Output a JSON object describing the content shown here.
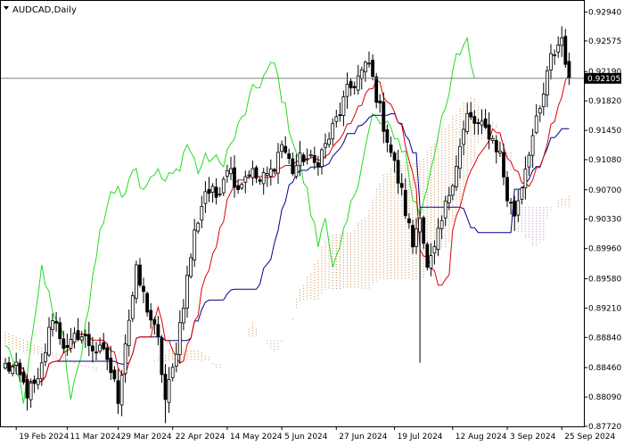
{
  "chart_data": {
    "type": "candlestick",
    "title": "AUDCAD,Daily",
    "symbol": "AUDCAD",
    "timeframe": "Daily",
    "last_price": "0.92105",
    "ylim": [
      0.8772,
      0.9308
    ],
    "y_ticks": [
      "0.92940",
      "0.92575",
      "0.92190",
      "0.91820",
      "0.91450",
      "0.91080",
      "0.90700",
      "0.90330",
      "0.89960",
      "0.89580",
      "0.89210",
      "0.88840",
      "0.88460",
      "0.88090",
      "0.87720"
    ],
    "x_ticks": [
      {
        "index": 3,
        "label": "19 Feb 2024"
      },
      {
        "index": 17,
        "label": "11 Mar 2024"
      },
      {
        "index": 31,
        "label": "29 Mar 2024"
      },
      {
        "index": 46,
        "label": "22 Apr 2024"
      },
      {
        "index": 61,
        "label": "14 May 2024"
      },
      {
        "index": 76,
        "label": "5 Jun 2024"
      },
      {
        "index": 91,
        "label": "27 Jun 2024"
      },
      {
        "index": 107,
        "label": "19 Jul 2024"
      },
      {
        "index": 123,
        "label": "12 Aug 2024"
      },
      {
        "index": 138,
        "label": "3 Sep 2024"
      },
      {
        "index": 153,
        "label": "25 Sep 2024"
      }
    ],
    "series_colors": {
      "bull_body": "#ffffff",
      "bear_body": "#000000",
      "candle_outline": "#000000",
      "tenkan": "#e00000",
      "kijun": "#00008b",
      "chikou": "#22dd22",
      "kumo_bull": "#cd853f",
      "kumo_bear": "#b48cb4",
      "last_price_label_bg": "#000000"
    },
    "close_anchors": [
      [
        0,
        0.8848
      ],
      [
        3,
        0.8842
      ],
      [
        6,
        0.8815
      ],
      [
        9,
        0.8825
      ],
      [
        13,
        0.8912
      ],
      [
        17,
        0.8865
      ],
      [
        20,
        0.889
      ],
      [
        24,
        0.8872
      ],
      [
        28,
        0.8858
      ],
      [
        31,
        0.8808
      ],
      [
        33,
        0.888
      ],
      [
        36,
        0.8965
      ],
      [
        39,
        0.8922
      ],
      [
        42,
        0.8878
      ],
      [
        44,
        0.8805
      ],
      [
        46,
        0.8842
      ],
      [
        49,
        0.893
      ],
      [
        52,
        0.9015
      ],
      [
        55,
        0.907
      ],
      [
        58,
        0.9062
      ],
      [
        61,
        0.9102
      ],
      [
        64,
        0.9075
      ],
      [
        67,
        0.9095
      ],
      [
        70,
        0.908
      ],
      [
        73,
        0.9092
      ],
      [
        76,
        0.9128
      ],
      [
        79,
        0.9095
      ],
      [
        82,
        0.9112
      ],
      [
        85,
        0.9102
      ],
      [
        88,
        0.9125
      ],
      [
        91,
        0.9158
      ],
      [
        94,
        0.9192
      ],
      [
        97,
        0.9212
      ],
      [
        100,
        0.9228
      ],
      [
        103,
        0.917
      ],
      [
        106,
        0.9118
      ],
      [
        109,
        0.9065
      ],
      [
        112,
        0.9
      ],
      [
        114,
        0.9045
      ],
      [
        116,
        0.8968
      ],
      [
        118,
        0.8992
      ],
      [
        121,
        0.9048
      ],
      [
        124,
        0.9105
      ],
      [
        127,
        0.9162
      ],
      [
        130,
        0.915
      ],
      [
        133,
        0.9142
      ],
      [
        136,
        0.9115
      ],
      [
        138,
        0.906
      ],
      [
        140,
        0.904
      ],
      [
        142,
        0.9078
      ],
      [
        144,
        0.9122
      ],
      [
        147,
        0.9168
      ],
      [
        150,
        0.9235
      ],
      [
        153,
        0.9262
      ],
      [
        155,
        0.921
      ]
    ],
    "spikes": [
      {
        "index": 44,
        "low": 0.8776
      },
      {
        "index": 114,
        "low": 0.8852
      },
      {
        "index": 140,
        "low": 0.9018
      }
    ]
  }
}
